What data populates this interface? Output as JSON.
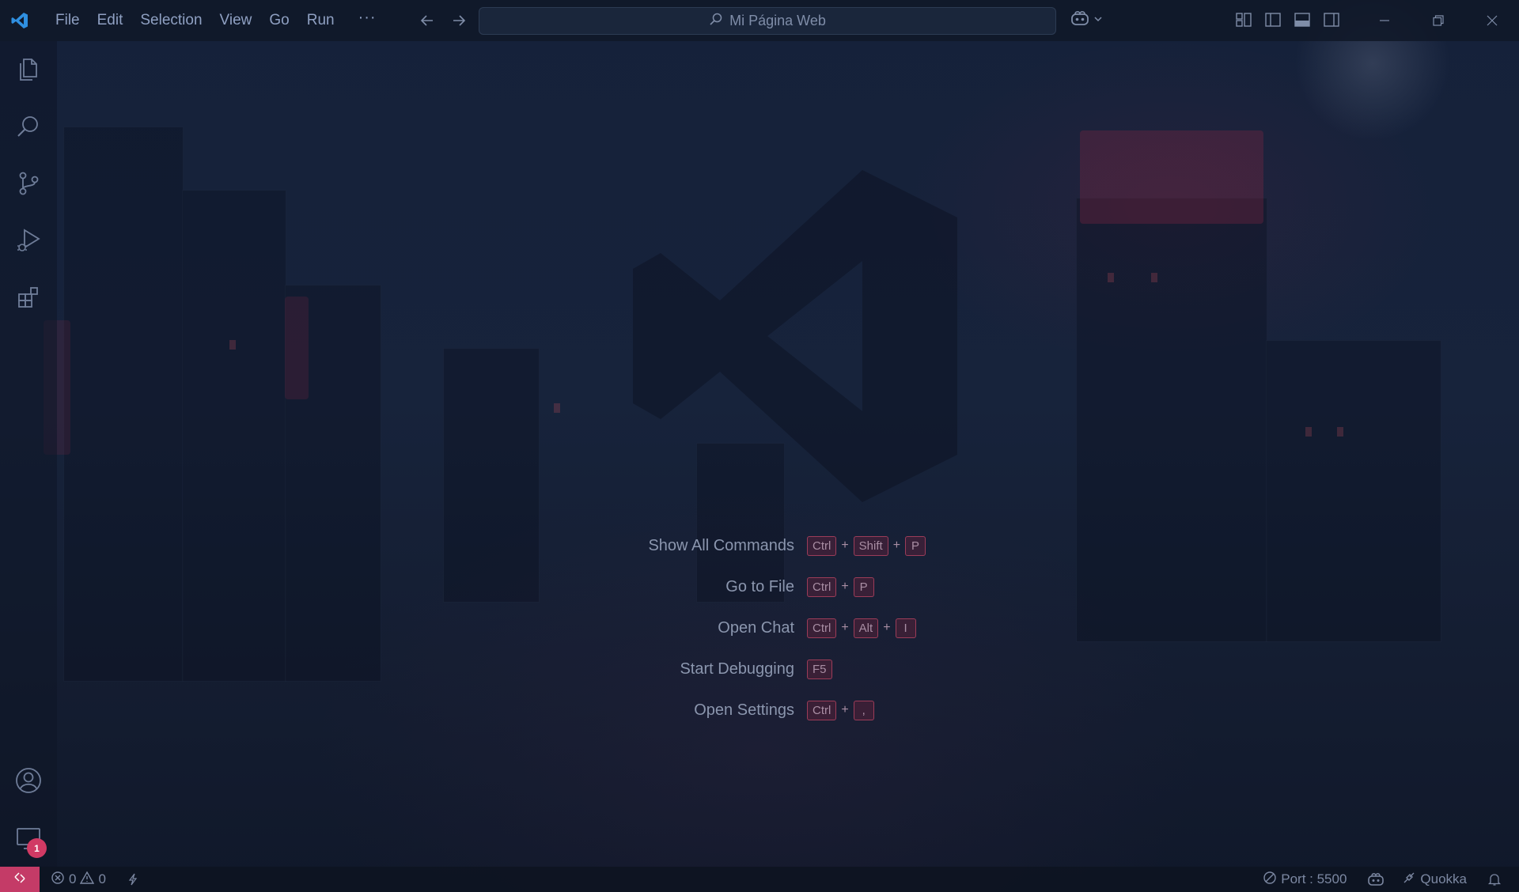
{
  "app": {
    "title": "Mi Página Web",
    "accent_color": "#c43b67",
    "logo_icon": "vscode-logo"
  },
  "menu": {
    "items": [
      "File",
      "Edit",
      "Selection",
      "View",
      "Go",
      "Run"
    ],
    "more": "···"
  },
  "activity_bar": {
    "items": [
      "explorer-icon",
      "search-icon",
      "source-control-icon",
      "run-debug-icon",
      "extensions-icon"
    ],
    "bottom": [
      "account-icon",
      "remote-explorer-icon"
    ],
    "badge_count": "1"
  },
  "shortcuts": [
    {
      "label": "Show All Commands",
      "keys": [
        "Ctrl",
        "Shift",
        "P"
      ]
    },
    {
      "label": "Go to File",
      "keys": [
        "Ctrl",
        "P"
      ]
    },
    {
      "label": "Open Chat",
      "keys": [
        "Ctrl",
        "Alt",
        "I"
      ]
    },
    {
      "label": "Start Debugging",
      "keys": [
        "F5"
      ]
    },
    {
      "label": "Open Settings",
      "keys": [
        "Ctrl",
        ","
      ]
    }
  ],
  "status_bar": {
    "errors": "0",
    "warnings": "0",
    "port": "Port : 5500",
    "quokka": "Quokka"
  }
}
